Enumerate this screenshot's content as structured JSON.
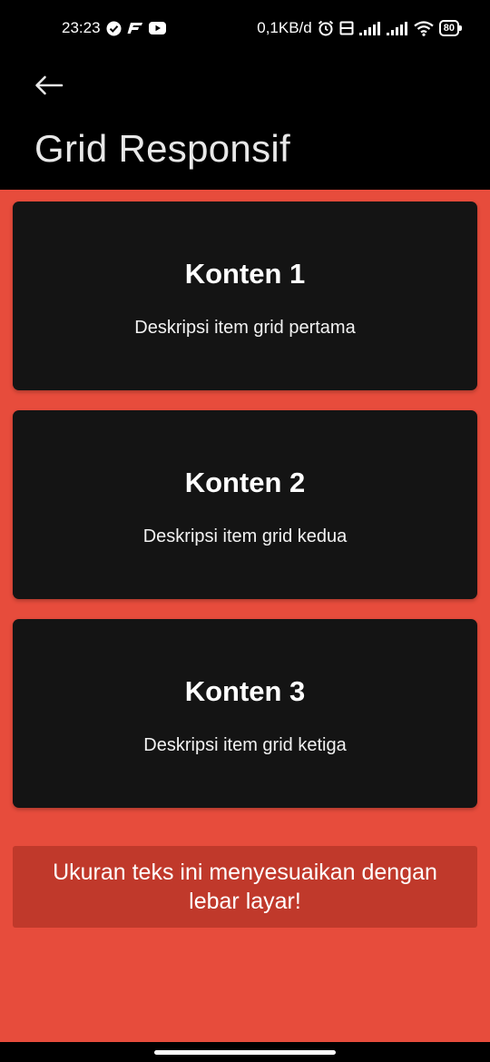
{
  "status_bar": {
    "time": "23:23",
    "net_speed": "0,1KB/d",
    "battery": "80",
    "icons": [
      "check-circle-icon",
      "f-app-icon",
      "youtube-icon",
      "alarm-icon",
      "volte-icon",
      "signal-icon",
      "signal-icon",
      "wifi-icon",
      "battery-icon"
    ]
  },
  "app_bar": {
    "back_icon": "arrow-left-icon",
    "title": "Grid Responsif"
  },
  "theme": {
    "background": "#e74c3c",
    "card": "#141414",
    "banner": "#c0392b",
    "app_bar": "#000000"
  },
  "cards": [
    {
      "title": "Konten 1",
      "description": "Deskripsi item grid pertama"
    },
    {
      "title": "Konten 2",
      "description": "Deskripsi item grid kedua"
    },
    {
      "title": "Konten 3",
      "description": "Deskripsi item grid ketiga"
    }
  ],
  "banner": {
    "text": "Ukuran teks ini menyesuaikan dengan lebar layar!"
  }
}
